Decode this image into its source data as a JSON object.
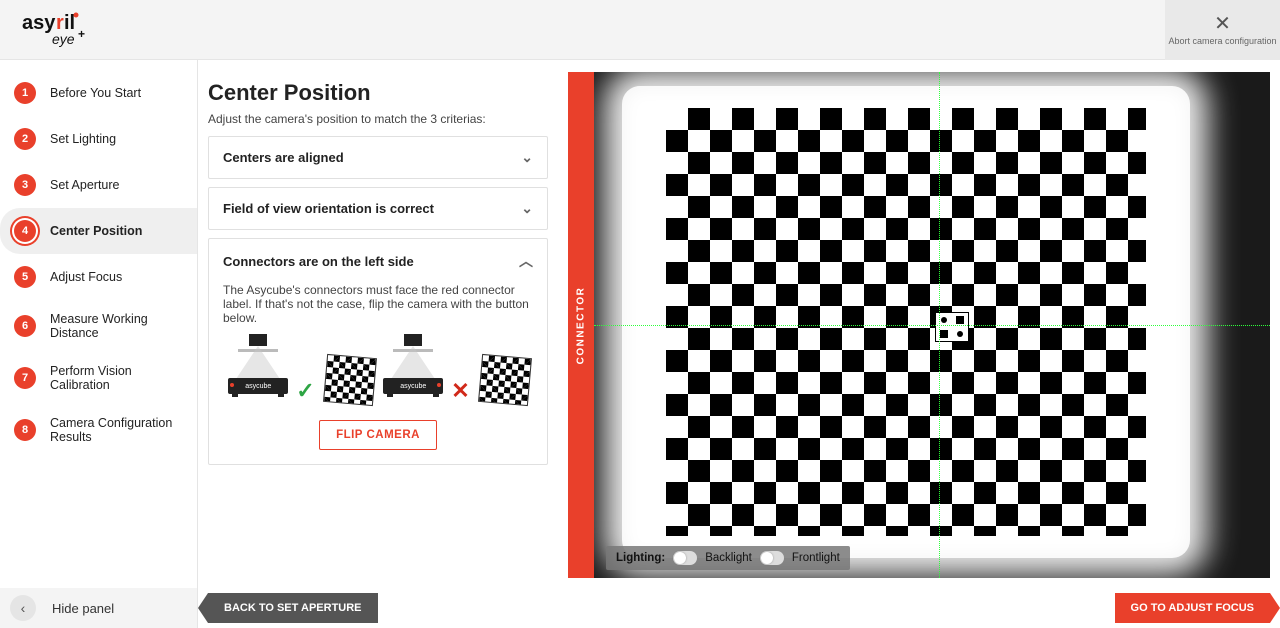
{
  "header": {
    "brand_top": "asyril",
    "brand_sub": "eye+",
    "abort_label": "Abort camera configuration"
  },
  "sidebar": {
    "items": [
      {
        "n": "1",
        "label": "Before You Start"
      },
      {
        "n": "2",
        "label": "Set Lighting"
      },
      {
        "n": "3",
        "label": "Set Aperture"
      },
      {
        "n": "4",
        "label": "Center Position"
      },
      {
        "n": "5",
        "label": "Adjust Focus"
      },
      {
        "n": "6",
        "label": "Measure Working Distance"
      },
      {
        "n": "7",
        "label": "Perform Vision Calibration"
      },
      {
        "n": "8",
        "label": "Camera Configuration Results"
      }
    ],
    "active_index": 3,
    "hide_panel_label": "Hide panel"
  },
  "center": {
    "title": "Center Position",
    "subtitle": "Adjust the camera's position to match the 3 criterias:",
    "acc1_title": "Centers are aligned",
    "acc2_title": "Field of view orientation is correct",
    "acc3_title": "Connectors are on the left side",
    "acc3_body": "The Asycube's connectors must face the red connector label. If that's not the case, flip the camera with the button below.",
    "asycube_label": "asycube",
    "flip_label": "FLIP CAMERA"
  },
  "preview": {
    "connector_label": "CONNECTOR",
    "lighting_label": "Lighting:",
    "backlight_label": "Backlight",
    "frontlight_label": "Frontlight",
    "backlight_on": false,
    "frontlight_on": false
  },
  "footer": {
    "back_label": "BACK TO SET APERTURE",
    "forward_label": "GO TO ADJUST FOCUS"
  },
  "colors": {
    "accent": "#e9402b",
    "crosshair": "#2eff3a"
  }
}
